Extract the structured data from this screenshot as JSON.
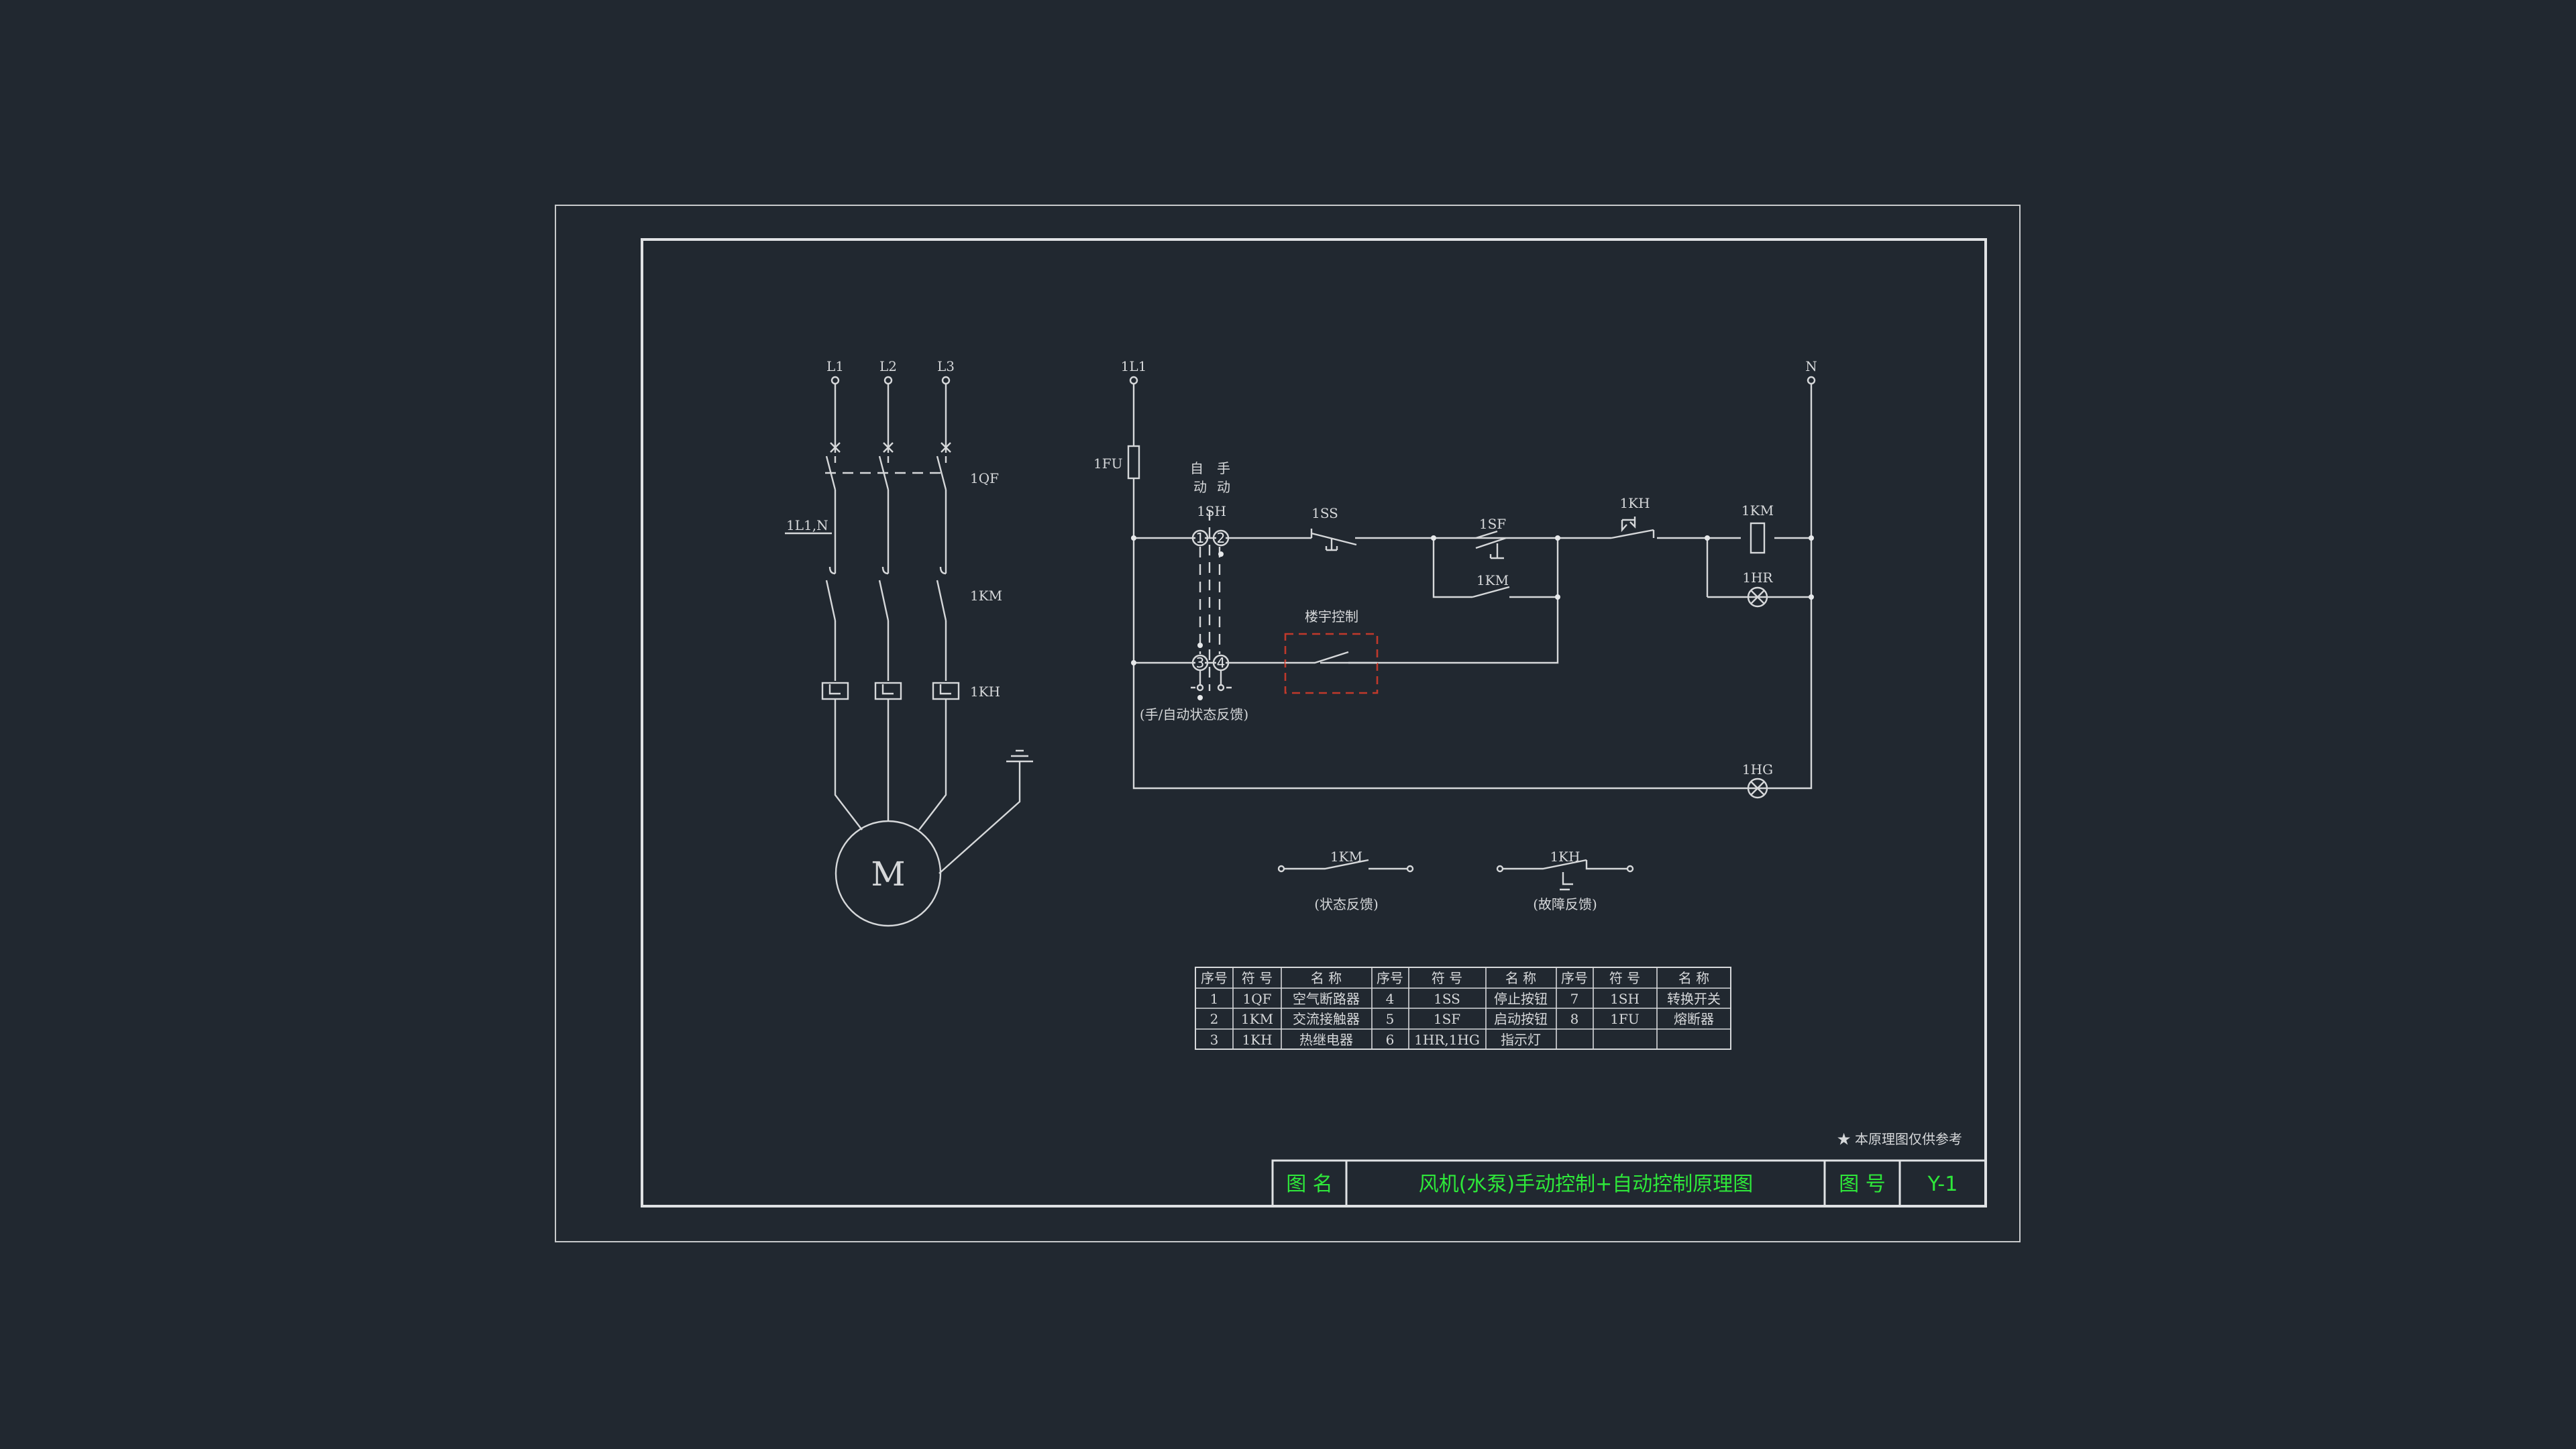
{
  "colors": {
    "background": "#212830",
    "line": "#d6d8da",
    "title_text": "#2ee83a",
    "red_box": "#c0392b"
  },
  "power": {
    "phases": [
      "L1",
      "L2",
      "L3"
    ],
    "qf": "1QF",
    "qf_note": "1L1,N",
    "km": "1KM",
    "kh": "1KH",
    "motor": "M"
  },
  "control": {
    "top_left": "1L1",
    "top_right": "N",
    "fuse": "1FU",
    "sw_auto": "自",
    "sw_manual": "手",
    "sw_auto2": "动",
    "sw_manual2": "动",
    "sh": "1SH",
    "ss": "1SS",
    "sf": "1SF",
    "kh": "1KH",
    "km_coil": "1KM",
    "km_aux": "1KM",
    "hr": "1HR",
    "hg": "1HG",
    "bldg": "楼宇控制",
    "terms": [
      "1",
      "2",
      "3",
      "4"
    ],
    "feedback_note": "(手/自动状态反馈)"
  },
  "feedback": {
    "km": "1KM",
    "km_note": "(状态反馈)",
    "kh": "1KH",
    "kh_note": "(故障反馈)"
  },
  "table": {
    "header": [
      "序号",
      "符 号",
      "名  称",
      "序号",
      "符  号",
      "名  称",
      "序号",
      "符 号",
      "名  称"
    ],
    "rows": [
      [
        "1",
        "1QF",
        "空气断路器",
        "4",
        "1SS",
        "停止按钮",
        "7",
        "1SH",
        "转换开关"
      ],
      [
        "2",
        "1KM",
        "交流接触器",
        "5",
        "1SF",
        "启动按钮",
        "8",
        "1FU",
        "熔断器"
      ],
      [
        "3",
        "1KH",
        "热继电器",
        "6",
        "1HR,1HG",
        "指示灯",
        "",
        "",
        ""
      ]
    ]
  },
  "note": "★ 本原理图仅供参考",
  "title_block": {
    "name_label": "图  名",
    "name": "风机(水泵)手动控制+自动控制原理图",
    "no_label": "图  号",
    "no": "Y-1"
  }
}
